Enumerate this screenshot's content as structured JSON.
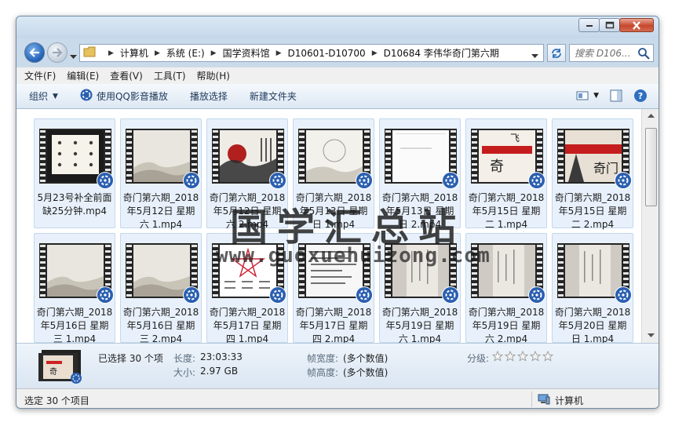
{
  "window": {
    "caption_buttons": [
      "minimize",
      "maximize",
      "close"
    ]
  },
  "address": {
    "crumbs": [
      "计算机",
      "系统 (E:)",
      "国学资料馆",
      "D10601-D10700",
      "D10684 李伟华奇门第六期"
    ],
    "search_placeholder": "搜索 D106..."
  },
  "menu": [
    "文件(F)",
    "编辑(E)",
    "查看(V)",
    "工具(T)",
    "帮助(H)"
  ],
  "toolbar": {
    "organize": "组织",
    "play_qq": "使用QQ影音播放",
    "play_selected": "播放选择",
    "new_folder": "新建文件夹"
  },
  "files": [
    {
      "line1": "5月23号补全前面",
      "line2": "缺25分钟.mp4",
      "line3": "",
      "thumb": "dark"
    },
    {
      "line1": "奇门第六期_2018",
      "line2": "年5月12日 星期",
      "line3": "六 1.mp4",
      "thumb": "misty"
    },
    {
      "line1": "奇门第六期_2018",
      "line2": "年5月12日 星期",
      "line3": "六 2.mp4",
      "thumb": "ink"
    },
    {
      "line1": "奇门第六期_2018",
      "line2": "年5月13日 星期",
      "line3": "日 1.mp4",
      "thumb": "pale"
    },
    {
      "line1": "奇门第六期_2018",
      "line2": "年5月13日 星期",
      "line3": "日 2.mp4",
      "thumb": "white"
    },
    {
      "line1": "奇门第六期_2018",
      "line2": "年5月15日 星期",
      "line3": "二 1.mp4",
      "thumb": "red"
    },
    {
      "line1": "奇门第六期_2018",
      "line2": "年5月15日 星期",
      "line3": "二 2.mp4",
      "thumb": "red2"
    },
    {
      "line1": "奇门第六期_2018",
      "line2": "年5月16日 星期",
      "line3": "三 1.mp4",
      "thumb": "misty"
    },
    {
      "line1": "奇门第六期_2018",
      "line2": "年5月16日 星期",
      "line3": "三 2.mp4",
      "thumb": "misty"
    },
    {
      "line1": "奇门第六期_2018",
      "line2": "年5月17日 星期",
      "line3": "四 1.mp4",
      "thumb": "star"
    },
    {
      "line1": "奇门第六期_2018",
      "line2": "年5月17日 星期",
      "line3": "四 2.mp4",
      "thumb": "doc"
    },
    {
      "line1": "奇门第六期_2018",
      "line2": "年5月19日 星期",
      "line3": "六 1.mp4",
      "thumb": "paper"
    },
    {
      "line1": "奇门第六期_2018",
      "line2": "年5月19日 星期",
      "line3": "六 2.mp4",
      "thumb": "paper"
    },
    {
      "line1": "奇门第六期_2018",
      "line2": "年5月20日 星期",
      "line3": "日 1.mp4",
      "thumb": "paper"
    }
  ],
  "watermark": {
    "cn": "国学汇总站",
    "url": "www.guoxuehuizong.com"
  },
  "details": {
    "selected": "已选择 30 个项",
    "length_label": "长度:",
    "length_value": "23:03:33",
    "size_label": "大小:",
    "size_value": "2.97 GB",
    "frame_width_label": "帧宽度:",
    "frame_width_value": "(多个数值)",
    "frame_height_label": "帧高度:",
    "frame_height_value": "(多个数值)",
    "rating_label": "分级:",
    "rating_stars": 0
  },
  "status": {
    "left": "选定 30 个项目",
    "right": "计算机"
  },
  "colors": {
    "accent_blue": "#1f5fb4",
    "qq_badge": "#2a5fb0",
    "selection_bg": "#e8f1fb"
  }
}
